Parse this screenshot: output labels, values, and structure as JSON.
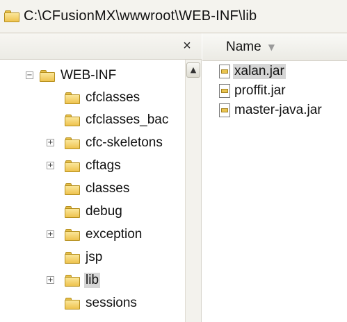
{
  "address_bar": {
    "path": "C:\\CFusionMX\\wwwroot\\WEB-INF\\lib"
  },
  "folder_pane": {
    "close_label": "×",
    "scroll_up_label": "▲",
    "tree": [
      {
        "label": "WEB-INF",
        "expander": "−",
        "icon": "folder-icon"
      },
      {
        "label": "cfclasses",
        "expander": "",
        "icon": "folder-icon"
      },
      {
        "label": "cfclasses_bac",
        "expander": "",
        "icon": "folder-icon"
      },
      {
        "label": "cfc-skeletons",
        "expander": "+",
        "icon": "folder-icon"
      },
      {
        "label": "cftags",
        "expander": "+",
        "icon": "folder-icon"
      },
      {
        "label": "classes",
        "expander": "",
        "icon": "folder-icon"
      },
      {
        "label": "debug",
        "expander": "",
        "icon": "folder-icon"
      },
      {
        "label": "exception",
        "expander": "+",
        "icon": "folder-icon"
      },
      {
        "label": "jsp",
        "expander": "",
        "icon": "folder-icon"
      },
      {
        "label": "lib",
        "expander": "+",
        "icon": "folder-icon",
        "selected": true
      },
      {
        "label": "sessions",
        "expander": "",
        "icon": "folder-icon"
      }
    ]
  },
  "file_pane": {
    "column_header": "Name",
    "sort_indicator": "▼",
    "files": [
      {
        "label": "xalan.jar",
        "icon": "jar-file-icon",
        "selected": true
      },
      {
        "label": "proffit.jar",
        "icon": "jar-file-icon"
      },
      {
        "label": "master-java.jar",
        "icon": "jar-file-icon"
      }
    ]
  },
  "colors": {
    "folder_yellow": "#eec24e",
    "selection_gray": "#d6d6d6",
    "header_bg": "#ecebe5"
  }
}
